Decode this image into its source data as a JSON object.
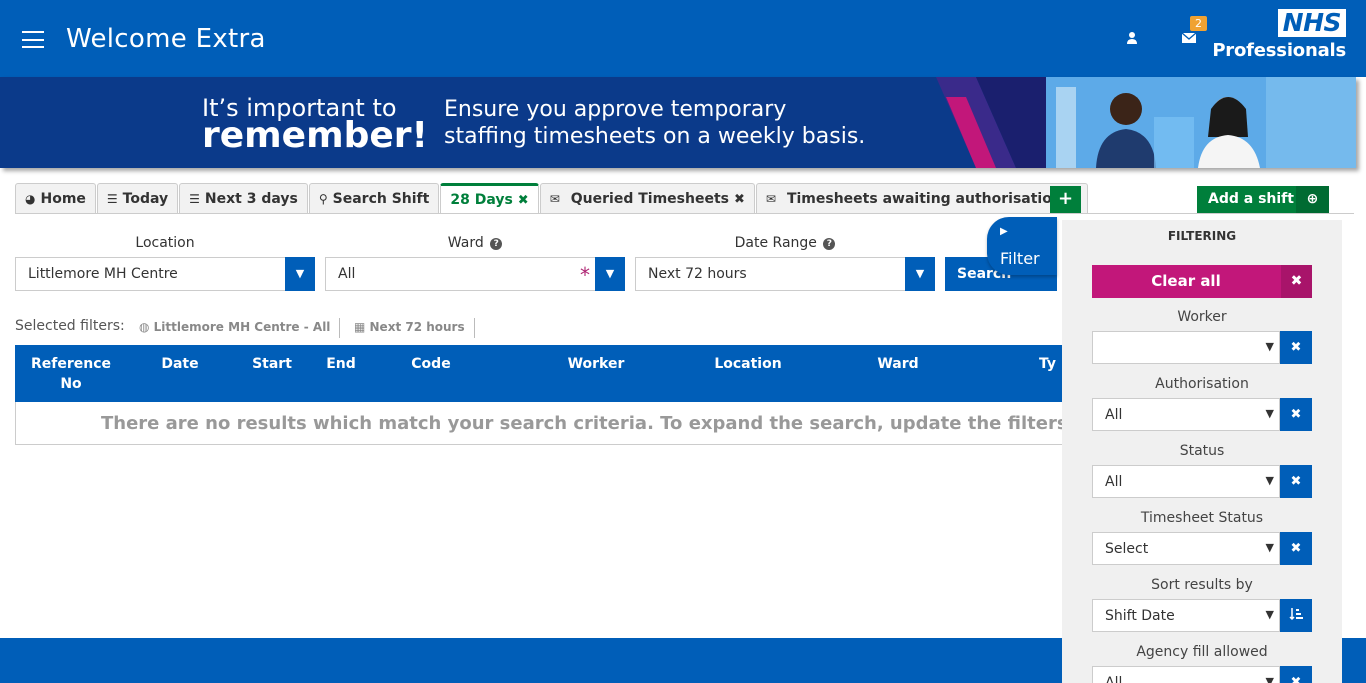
{
  "header": {
    "title": "Welcome Extra",
    "mail_count": "2",
    "logo_nhs": "NHS",
    "logo_sub": "Professionals"
  },
  "banner": {
    "left_line1": "It’s important to",
    "left_line2": "remember!",
    "right_line1": "Ensure you approve temporary",
    "right_line2": "staffing timesheets on a weekly basis."
  },
  "tabs": [
    {
      "label": "Home",
      "icon": "dashboard-icon"
    },
    {
      "label": "Today",
      "icon": "list-icon"
    },
    {
      "label": "Next 3 days",
      "icon": "list-icon"
    },
    {
      "label": "Search Shift",
      "icon": "search-icon"
    },
    {
      "label": "28 Days",
      "icon": "close-icon",
      "active": true
    },
    {
      "label": "Queried Timesheets",
      "icon": "envelope-icon"
    },
    {
      "label": "Timesheets awaiting authorisation",
      "icon": "envelope-icon"
    }
  ],
  "actions": {
    "add_tab": "+",
    "add_shift": "Add a shift"
  },
  "filters": {
    "location_label": "Location",
    "location_value": "Littlemore MH Centre",
    "ward_label": "Ward",
    "ward_value": "All",
    "date_range_label": "Date Range",
    "date_range_value": "Next 72 hours",
    "search_label": "Search"
  },
  "selected_filters": {
    "label": "Selected filters:",
    "chips": [
      "Littlemore MH Centre - All",
      "Next 72 hours"
    ]
  },
  "table": {
    "columns": [
      "Reference No",
      "Date",
      "Start",
      "End",
      "Code",
      "Worker",
      "Location",
      "Ward",
      "Ty"
    ],
    "empty_message": "There are no results which match your search criteria. To expand the search, update the filters"
  },
  "panel": {
    "title": "FILTERING",
    "clear_all": "Clear all",
    "toggle_label": "Filter",
    "fields": [
      {
        "label": "Worker",
        "value": ""
      },
      {
        "label": "Authorisation",
        "value": "All"
      },
      {
        "label": "Status",
        "value": "All"
      },
      {
        "label": "Timesheet Status",
        "value": "Select"
      },
      {
        "label": "Sort results by",
        "value": "Shift Date"
      },
      {
        "label": "Agency fill allowed",
        "value": "All"
      }
    ]
  },
  "colors": {
    "nhs_blue": "#005eb8",
    "banner_blue": "#0b3a8a",
    "green": "#007f3b",
    "pink": "#c2177a",
    "badge": "#f0a232"
  }
}
